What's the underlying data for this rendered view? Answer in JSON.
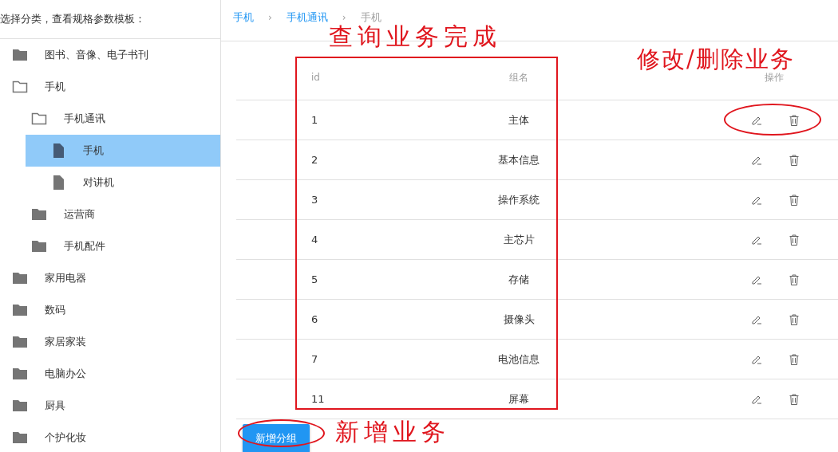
{
  "sidebar": {
    "title": "选择分类，查看规格参数模板：",
    "tree": [
      {
        "label": "图书、音像、电子书刊",
        "kind": "folder",
        "expanded": false,
        "selected": false
      },
      {
        "label": "手机",
        "kind": "folder",
        "expanded": true,
        "selected": false,
        "children": [
          {
            "label": "手机通讯",
            "kind": "folder",
            "expanded": true,
            "selected": false,
            "children": [
              {
                "label": "手机",
                "kind": "file",
                "selected": true
              },
              {
                "label": "对讲机",
                "kind": "file",
                "selected": false
              }
            ]
          },
          {
            "label": "运营商",
            "kind": "folder",
            "expanded": false,
            "selected": false
          },
          {
            "label": "手机配件",
            "kind": "folder",
            "expanded": false,
            "selected": false
          }
        ]
      },
      {
        "label": "家用电器",
        "kind": "folder",
        "expanded": false,
        "selected": false
      },
      {
        "label": "数码",
        "kind": "folder",
        "expanded": false,
        "selected": false
      },
      {
        "label": "家居家装",
        "kind": "folder",
        "expanded": false,
        "selected": false
      },
      {
        "label": "电脑办公",
        "kind": "folder",
        "expanded": false,
        "selected": false
      },
      {
        "label": "厨具",
        "kind": "folder",
        "expanded": false,
        "selected": false
      },
      {
        "label": "个护化妆",
        "kind": "folder",
        "expanded": false,
        "selected": false
      }
    ]
  },
  "breadcrumb": [
    {
      "label": "手机",
      "link": true
    },
    {
      "separator": "›"
    },
    {
      "label": "手机通讯",
      "link": true
    },
    {
      "separator": "›"
    },
    {
      "label": "手机",
      "link": false
    }
  ],
  "table": {
    "columns": [
      "id",
      "组名",
      "操作"
    ],
    "rows": [
      {
        "id": "1",
        "name": "主体"
      },
      {
        "id": "2",
        "name": "基本信息"
      },
      {
        "id": "3",
        "name": "操作系统"
      },
      {
        "id": "4",
        "name": "主芯片"
      },
      {
        "id": "5",
        "name": "存储"
      },
      {
        "id": "6",
        "name": "摄像头"
      },
      {
        "id": "7",
        "name": "电池信息"
      },
      {
        "id": "11",
        "name": "屏幕"
      }
    ]
  },
  "add_button": "新增分组",
  "annotations": [
    "查询业务完成",
    "修改/删除业务",
    "新增业务"
  ]
}
